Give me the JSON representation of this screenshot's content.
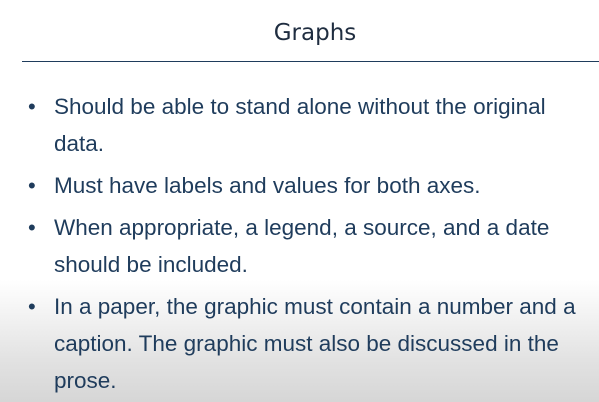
{
  "slide": {
    "title": "Graphs",
    "bullets": [
      "Should be able to stand alone without the original data.",
      "Must have labels and values for both axes.",
      "When appropriate, a legend, a source, and a date should be included.",
      "In a paper, the graphic must contain a number and a caption. The graphic must also be discussed in the prose."
    ],
    "bullet_glyph": "•"
  }
}
